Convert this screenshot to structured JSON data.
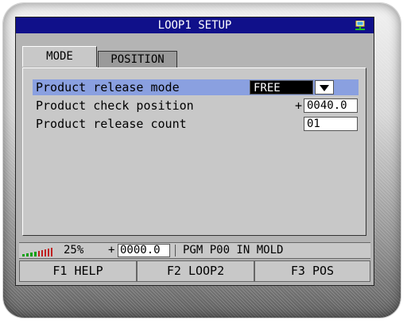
{
  "window": {
    "title": "LOOP1 SETUP",
    "title_bar_color": "#10108a",
    "status_icon": "network-icon"
  },
  "tabs": [
    {
      "label": "MODE",
      "active": true
    },
    {
      "label": "POSITION",
      "active": false
    }
  ],
  "settings": {
    "release_mode": {
      "label": "Product release mode",
      "value": "FREE",
      "selected": true
    },
    "check_position": {
      "label": "Product check position",
      "sign": "+",
      "value": "0040.0"
    },
    "release_count": {
      "label": "Product release count",
      "value": "01"
    }
  },
  "status_bar": {
    "signal_icon": "signal-strength-icon",
    "signal_percent": "25%",
    "sign": "+",
    "value": "0000.0",
    "program_text": "PGM P00 IN MOLD"
  },
  "function_keys": [
    {
      "label": "F1 HELP"
    },
    {
      "label": "F2 LOOP2"
    },
    {
      "label": "F3 POS"
    }
  ],
  "colors": {
    "selection_highlight": "#8aa0e0",
    "panel": "#c8c8c8",
    "screen_bg": "#b4b4b4"
  }
}
